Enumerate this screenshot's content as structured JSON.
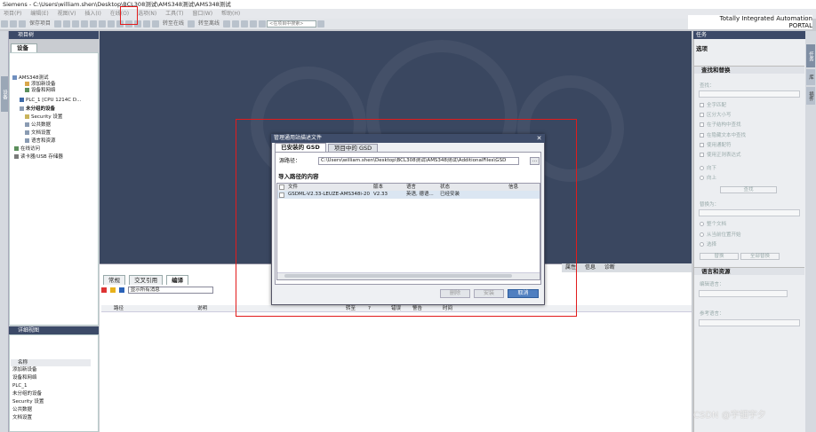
{
  "titlebar": {
    "title": "Siemens  -  C:\\Users\\william.shen\\Desktop\\BCL308测试\\AMS348测试\\AMS348测试"
  },
  "brand": {
    "line1": "Totally Integrated Automation",
    "line2": "PORTAL"
  },
  "menu": [
    "项目(P)",
    "编辑(E)",
    "视图(V)",
    "插入(I)",
    "在线(O)",
    "选项(N)",
    "工具(T)",
    "窗口(W)",
    "帮助(H)"
  ],
  "toolbar": {
    "save_label": "保存项目",
    "go_online": "转至在线",
    "go_offline": "转至离线",
    "search_placeholder": "<在项目中搜索>"
  },
  "left": {
    "project_tree_title": "项目树",
    "devices_tab": "设备",
    "side_tab": "设备",
    "tree": [
      {
        "label": "AMS348测试",
        "indent": 0
      },
      {
        "label": "添加新设备",
        "indent": 1
      },
      {
        "label": "设备和网络",
        "indent": 1
      },
      {
        "label": "PLC_1 [CPU 1214C D...",
        "indent": 1
      },
      {
        "label": "未分组的设备",
        "indent": 1
      },
      {
        "label": "Security 设置",
        "indent": 1
      },
      {
        "label": "公共数据",
        "indent": 1
      },
      {
        "label": "文档设置",
        "indent": 1
      },
      {
        "label": "语言和资源",
        "indent": 1
      },
      {
        "label": "在线访问",
        "indent": 0
      },
      {
        "label": "读卡器/USB 存储器",
        "indent": 0
      }
    ],
    "detail_title": "详细视图",
    "detail_col": "名称",
    "detail_items": [
      "添加新设备",
      "设备和网络",
      "PLC_1",
      "未分组的设备",
      "Security 设置",
      "公共数据",
      "文档设置"
    ]
  },
  "inspector": {
    "tabs": [
      "常规",
      "交叉引用",
      "编译"
    ],
    "right_tabs": [
      "属性",
      "信息",
      "诊断"
    ],
    "filter": "显示所有消息",
    "cols": [
      "路径",
      "说明",
      "转至",
      "?",
      "错误",
      "警告",
      "时间"
    ]
  },
  "right": {
    "task_title": "任务",
    "options": "选项",
    "find_replace": "查找和替换",
    "find_label": "查找：",
    "checks": [
      "全字匹配",
      "区分大小写",
      "在子结构中查找",
      "在隐藏文本中查找",
      "使用通配符",
      "使用正则表达式"
    ],
    "dirs": [
      "向下",
      "向上"
    ],
    "find_btn": "查找",
    "replace_label": "替换为：",
    "scope": [
      "整个文档",
      "从当前位置开始",
      "选择"
    ],
    "replace_btn": "替换",
    "replace_all_btn": "全部替换",
    "lang_section": "语言和资源",
    "edit_lang": "编辑语言：",
    "ref_lang": "参考语言：",
    "strip_tabs": [
      "任务",
      "库",
      "插件"
    ]
  },
  "dialog": {
    "title": "管理通用站描述文件",
    "tab_installed": "已安装的 GSD",
    "tab_project": "项目中的 GSD",
    "source_label": "源路径：",
    "source_path": "C:\\Users\\william.shen\\Desktop\\BCL308测试\\AMS348测试\\AdditionalFiles\\GSD",
    "browse": "...",
    "content_label": "导入路径的内容",
    "columns": [
      "文件",
      "版本",
      "语言",
      "状态",
      "信息"
    ],
    "rows": [
      {
        "file": "GSDML-V2.33-LEUZE-AMS348i-20...",
        "version": "V2.33",
        "language": "英语, 德语...",
        "status": "已经安装",
        "info": ""
      }
    ],
    "delete_btn": "删除",
    "install_btn": "安装",
    "cancel_btn": "取消"
  },
  "watermark": "CSDN @宇钿宇夕",
  "colors": {
    "title_bar": "#3c4a68",
    "workspace": "#3a4760",
    "annotation": "#e21b1b",
    "primary_button": "#4f7fc0"
  }
}
